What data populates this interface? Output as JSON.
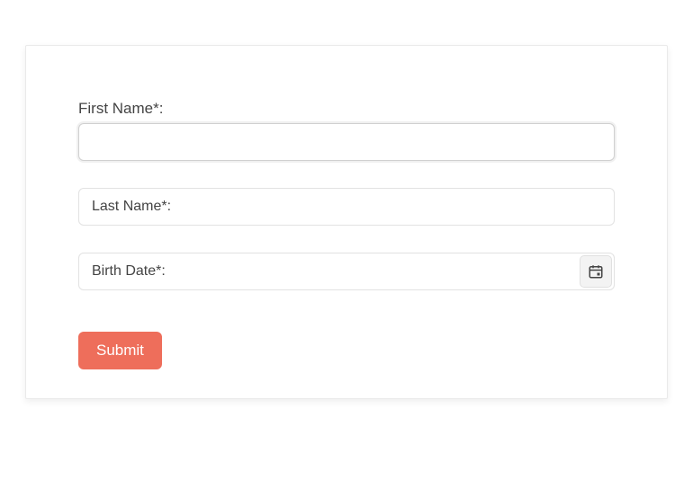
{
  "form": {
    "first_name": {
      "label": "First Name*:",
      "value": ""
    },
    "last_name": {
      "placeholder": "Last Name*:",
      "value": ""
    },
    "birth_date": {
      "placeholder": "Birth Date*:",
      "value": ""
    },
    "submit_label": "Submit"
  },
  "icons": {
    "calendar": "calendar-icon"
  },
  "colors": {
    "accent": "#ee6e5b"
  }
}
